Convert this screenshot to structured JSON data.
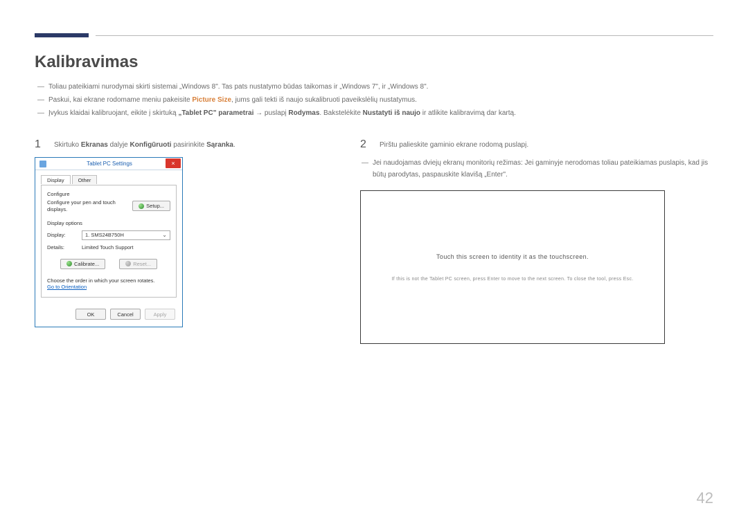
{
  "pageNumber": "42",
  "title": "Kalibravimas",
  "intro": [
    {
      "pre": "Toliau pateikiami nurodymai skirti sistemai „Windows 8\". Tas pats nustatymo būdas taikomas ir „Windows 7\", ir „Windows 8\"."
    },
    {
      "pre": "Paskui, kai ekrane rodomame meniu pakeisite ",
      "orange": "Picture Size",
      "post": ", jums gali tekti iš naujo sukalibruoti paveikslėlių nustatymus."
    },
    {
      "pre": "Įvykus klaidai kalibruojant, eikite į skirtuką ",
      "b1": "„Tablet PC\" parametrai",
      "arrow": " → ",
      "mid": "puslapį ",
      "b2": "Rodymas",
      "post2": ". Bakstelėkite ",
      "b3": "Nustatyti iš naujo",
      "post3": " ir atlikite kalibravimą dar kartą."
    }
  ],
  "left": {
    "stepNum": "1",
    "stepParts": {
      "p1": "Skirtuko ",
      "b1": "Ekranas",
      "p2": " dalyje ",
      "b2": "Konfigūruoti",
      "p3": " pasirinkite ",
      "b3": "Sąranka",
      "p4": "."
    }
  },
  "dialog": {
    "title": "Tablet PC Settings",
    "close": "×",
    "tabs": {
      "active": "Display",
      "other": "Other"
    },
    "configure": {
      "label": "Configure",
      "text": "Configure your pen and touch displays.",
      "btn": "Setup..."
    },
    "displayOptions": {
      "label": "Display options",
      "displayLabel": "Display:",
      "displayValue": "1. SMS24B750H",
      "detailsLabel": "Details:",
      "detailsValue": "Limited Touch Support"
    },
    "buttons": {
      "calibrate": "Calibrate...",
      "reset": "Reset..."
    },
    "order": {
      "text": "Choose the order in which your screen rotates.",
      "link": "Go to Orientation"
    },
    "footer": {
      "ok": "OK",
      "cancel": "Cancel",
      "apply": "Apply"
    }
  },
  "right": {
    "stepNum": "2",
    "stepText": "Pirštu palieskite gaminio ekrane rodomą puslapį.",
    "note": "Jei naudojamas dviejų ekranų monitorių režimas: Jei gaminyje nerodomas toliau pateikiamas puslapis, kad jis būtų parodytas, paspauskite klavišą „Enter\"."
  },
  "touch": {
    "main": "Touch this screen to identity it as the touchscreen.",
    "sub": "If this is not the Tablet PC screen, press Enter to move to the next screen. To close the tool, press Esc."
  }
}
